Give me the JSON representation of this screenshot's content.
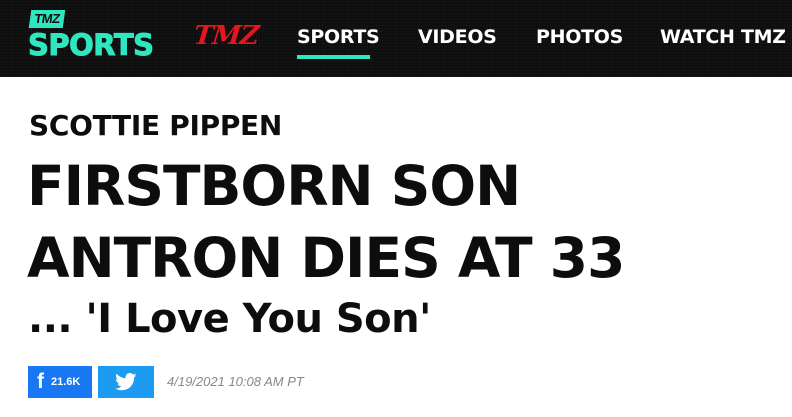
{
  "header": {
    "brand": {
      "badge": "TMZ",
      "wordmark": "SPORTS",
      "parent_logo": "TMZ"
    },
    "nav": [
      {
        "label": "SPORTS",
        "active": true
      },
      {
        "label": "VIDEOS",
        "active": false
      },
      {
        "label": "PHOTOS",
        "active": false
      },
      {
        "label": "WATCH TMZ",
        "active": false
      }
    ]
  },
  "article": {
    "kicker": "SCOTTIE PIPPEN",
    "headline_lines": [
      "FIRSTBORN SON",
      "ANTRON DIES AT 33"
    ],
    "subhead": "... 'I Love You Son'",
    "share": {
      "facebook_icon": "f",
      "facebook_count": "21.6K",
      "twitter_icon": "twitter-bird-icon"
    },
    "timestamp": "4/19/2021 10:08 AM PT"
  },
  "colors": {
    "accent": "#2ee6c0",
    "tmz_red": "#e8151f",
    "header_bg": "#0d0d0d",
    "facebook": "#1877f2",
    "twitter": "#1d9bf0"
  }
}
